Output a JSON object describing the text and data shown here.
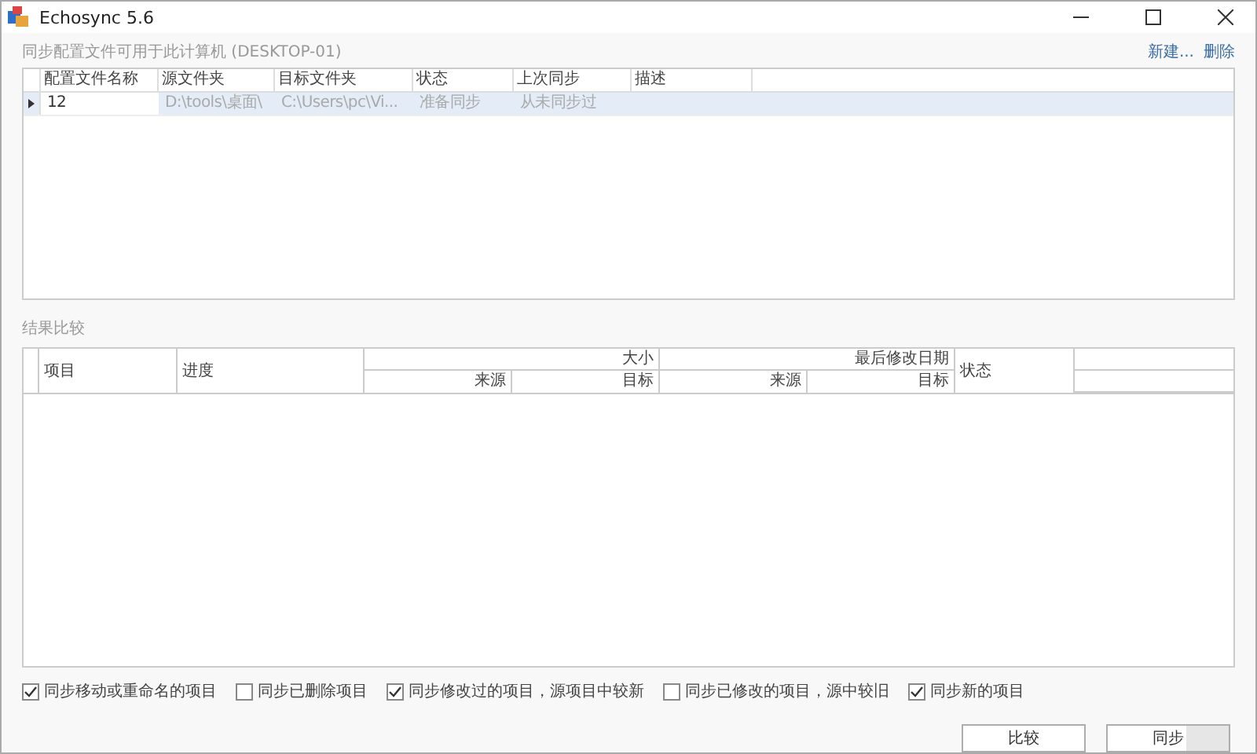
{
  "window": {
    "title": "Echosync 5.6"
  },
  "profiles": {
    "label": "同步配置文件可用于此计算机 (DESKTOP-01)",
    "actions": [
      "新建...",
      "删除"
    ],
    "columns": [
      "配置文件名称",
      "源文件夹",
      "目标文件夹",
      "状态",
      "上次同步",
      "描述"
    ],
    "rows": [
      {
        "selected": true,
        "cells": [
          "12",
          "D:\\tools\\桌面\\",
          "C:\\Users\\pc\\Vi...",
          "准备同步",
          "从未同步过",
          ""
        ]
      }
    ]
  },
  "results": {
    "label": "结果比较",
    "columns": {
      "item": "项目",
      "progress": "进度",
      "size": {
        "title": "大小",
        "sub": [
          "来源",
          "目标"
        ]
      },
      "modified": {
        "title": "最后修改日期",
        "sub": [
          "来源",
          "目标"
        ]
      },
      "status": "状态"
    }
  },
  "options": [
    {
      "label": "同步移动或重命名的项目",
      "checked": true
    },
    {
      "label": "同步已删除项目",
      "checked": false
    },
    {
      "label": "同步修改过的项目，源项目中较新",
      "checked": true
    },
    {
      "label": "同步已修改的项目，源中较旧",
      "checked": false
    },
    {
      "label": "同步新的项目",
      "checked": true
    }
  ],
  "buttons": [
    {
      "label": "比较",
      "kind": "plain"
    },
    {
      "label": "同步",
      "kind": "progress"
    }
  ]
}
